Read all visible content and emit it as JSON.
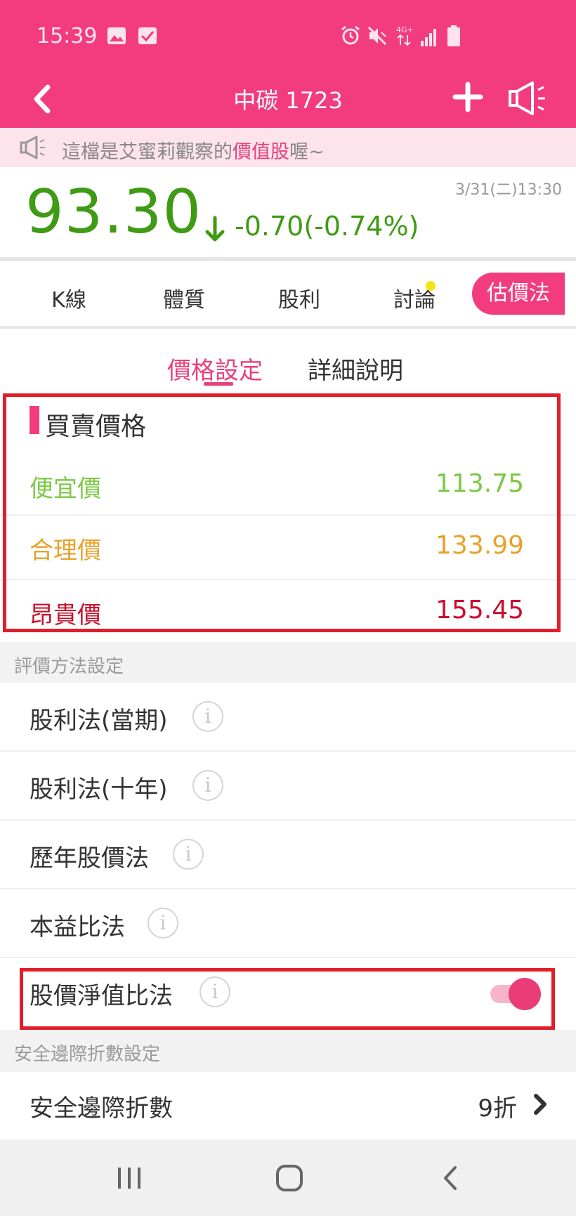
{
  "status_bar": {
    "time": "15:39",
    "icons": [
      "image-icon",
      "check-box-icon",
      "alarm-icon",
      "mute-icon",
      "4g-lte-icon",
      "signal-icon",
      "battery-icon"
    ],
    "network_label": "4G+"
  },
  "app_bar": {
    "title": "中碳 1723",
    "icons": [
      "back-icon",
      "plus-icon",
      "megaphone-icon"
    ]
  },
  "notice": {
    "prefix": "這檔是艾蜜莉觀察的",
    "highlight": "價值股",
    "suffix": "喔~"
  },
  "quote": {
    "price": "93.30",
    "change": "-0.70(-0.74%)",
    "timestamp": "3/31(二)13:30"
  },
  "tabs": [
    {
      "label": "K線"
    },
    {
      "label": "體質"
    },
    {
      "label": "股利"
    },
    {
      "label": "討論"
    },
    {
      "label": "估價法"
    }
  ],
  "subtabs": {
    "active": "價格設定",
    "inactive": "詳細說明"
  },
  "price_section": {
    "title": "買賣價格",
    "rows": [
      {
        "label": "便宜價",
        "value": "113.75"
      },
      {
        "label": "合理價",
        "value": "133.99"
      },
      {
        "label": "昂貴價",
        "value": "155.45"
      }
    ]
  },
  "method_section": {
    "header": "評價方法設定",
    "methods": [
      {
        "label": "股利法(當期)"
      },
      {
        "label": "股利法(十年)"
      },
      {
        "label": "歷年股價法"
      },
      {
        "label": "本益比法"
      },
      {
        "label": "股價淨值比法",
        "toggle_on": true
      }
    ],
    "info_glyph": "i"
  },
  "margin_section": {
    "header": "安全邊際折數設定",
    "label": "安全邊際折數",
    "value": "9折"
  },
  "colors": {
    "brand_pink": "#f23c7d",
    "price_green": "#3f9a14",
    "cheap_green": "#7ac943",
    "fair_orange": "#e8a12a",
    "expensive_red": "#c8102e",
    "highlight_box": "#e01f2a"
  }
}
